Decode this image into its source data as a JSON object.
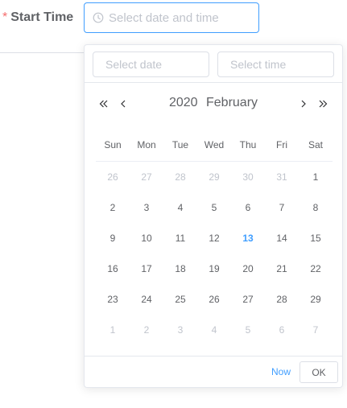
{
  "form": {
    "required_mark": "*",
    "label": "Start Time",
    "input_placeholder": "Select date and time",
    "input_value": ""
  },
  "picker": {
    "date_input_placeholder": "Select date",
    "time_input_placeholder": "Select time",
    "year": "2020",
    "month": "February",
    "weekdays": [
      "Sun",
      "Mon",
      "Tue",
      "Wed",
      "Thu",
      "Fri",
      "Sat"
    ],
    "days": [
      {
        "label": "26",
        "state": "prev"
      },
      {
        "label": "27",
        "state": "prev"
      },
      {
        "label": "28",
        "state": "prev"
      },
      {
        "label": "29",
        "state": "prev"
      },
      {
        "label": "30",
        "state": "prev"
      },
      {
        "label": "31",
        "state": "prev"
      },
      {
        "label": "1",
        "state": "current"
      },
      {
        "label": "2",
        "state": "current"
      },
      {
        "label": "3",
        "state": "current"
      },
      {
        "label": "4",
        "state": "current"
      },
      {
        "label": "5",
        "state": "current"
      },
      {
        "label": "6",
        "state": "current"
      },
      {
        "label": "7",
        "state": "current"
      },
      {
        "label": "8",
        "state": "current"
      },
      {
        "label": "9",
        "state": "current"
      },
      {
        "label": "10",
        "state": "current"
      },
      {
        "label": "11",
        "state": "current"
      },
      {
        "label": "12",
        "state": "current"
      },
      {
        "label": "13",
        "state": "today"
      },
      {
        "label": "14",
        "state": "current"
      },
      {
        "label": "15",
        "state": "current"
      },
      {
        "label": "16",
        "state": "current"
      },
      {
        "label": "17",
        "state": "current"
      },
      {
        "label": "18",
        "state": "current"
      },
      {
        "label": "19",
        "state": "current"
      },
      {
        "label": "20",
        "state": "current"
      },
      {
        "label": "21",
        "state": "current"
      },
      {
        "label": "22",
        "state": "current"
      },
      {
        "label": "23",
        "state": "current"
      },
      {
        "label": "24",
        "state": "current"
      },
      {
        "label": "25",
        "state": "current"
      },
      {
        "label": "26",
        "state": "current"
      },
      {
        "label": "27",
        "state": "current"
      },
      {
        "label": "28",
        "state": "current"
      },
      {
        "label": "29",
        "state": "current"
      },
      {
        "label": "1",
        "state": "next"
      },
      {
        "label": "2",
        "state": "next"
      },
      {
        "label": "3",
        "state": "next"
      },
      {
        "label": "4",
        "state": "next"
      },
      {
        "label": "5",
        "state": "next"
      },
      {
        "label": "6",
        "state": "next"
      },
      {
        "label": "7",
        "state": "next"
      }
    ],
    "footer": {
      "now_label": "Now",
      "ok_label": "OK"
    }
  },
  "icons": {
    "input_prefix": "clock-icon",
    "prev_year": "double-chevron-left-icon",
    "prev_month": "chevron-left-icon",
    "next_month": "chevron-right-icon",
    "next_year": "double-chevron-right-icon"
  },
  "colors": {
    "accent": "#409eff",
    "required": "#f56c6c",
    "text": "#606266",
    "muted": "#c0c4cc",
    "border": "#dcdfe6"
  }
}
